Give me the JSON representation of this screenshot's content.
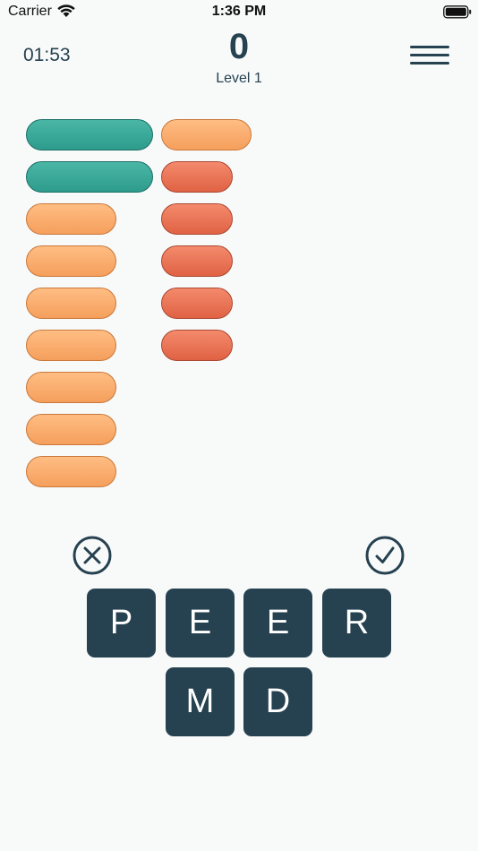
{
  "status": {
    "carrier": "Carrier",
    "time": "1:36 PM"
  },
  "header": {
    "timer": "01:53",
    "score": "0",
    "level": "Level 1"
  },
  "colors": {
    "primary": "#26414f",
    "found_slot": "#2e9c8c",
    "empty_slot": "#f59f5c",
    "hot_slot": "#e06244",
    "tile": "#264251"
  },
  "word_slots": {
    "column_1": [
      "found",
      "found",
      "empty",
      "empty",
      "empty",
      "empty",
      "empty",
      "empty",
      "empty"
    ],
    "column_2": [
      "empty",
      "hot",
      "hot",
      "hot",
      "hot",
      "hot"
    ]
  },
  "controls": {
    "clear_icon": "close-circle-icon",
    "submit_icon": "check-circle-icon"
  },
  "letters": [
    "P",
    "E",
    "E",
    "R",
    "M",
    "D"
  ]
}
